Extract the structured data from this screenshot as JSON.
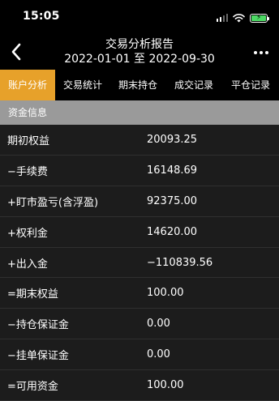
{
  "status": {
    "time": "15:05",
    "battery_color": "#4cd964"
  },
  "nav": {
    "title": "交易分析报告",
    "subtitle": "2022-01-01 至 2022-09-30",
    "back_icon": "chevron-left-icon",
    "more_icon": "more-dots-icon"
  },
  "tabs": [
    {
      "label": "账户分析",
      "active": true
    },
    {
      "label": "交易统计",
      "active": false
    },
    {
      "label": "期末持仓",
      "active": false
    },
    {
      "label": "成交记录",
      "active": false
    },
    {
      "label": "平仓记录",
      "active": false
    }
  ],
  "section": {
    "title": "资金信息"
  },
  "rows": [
    {
      "label": "期初权益",
      "value": "20093.25"
    },
    {
      "label": "−手续费",
      "value": "16148.69"
    },
    {
      "label": "+盯市盈亏(含浮盈)",
      "value": "92375.00"
    },
    {
      "label": "+权利金",
      "value": "14620.00"
    },
    {
      "label": "+出入金",
      "value": "−110839.56"
    },
    {
      "label": "=期末权益",
      "value": "100.00"
    },
    {
      "label": "−持仓保证金",
      "value": "0.00"
    },
    {
      "label": "−挂单保证金",
      "value": "0.00"
    },
    {
      "label": "=可用资金",
      "value": "100.00"
    }
  ],
  "colors": {
    "accent": "#e7a12a",
    "section_bg": "#9a9a9a",
    "background": "#1c1c1c"
  }
}
